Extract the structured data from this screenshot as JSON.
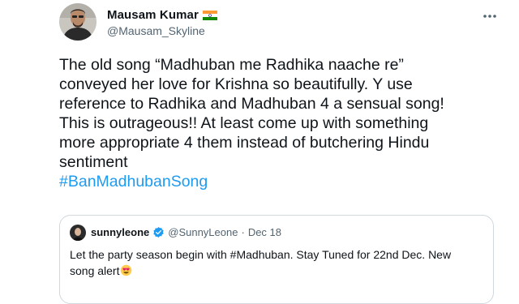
{
  "author": {
    "name": "Mausam Kumar",
    "handle": "@Mausam_Skyline",
    "flag": "india-flag-icon"
  },
  "tweet": {
    "lines": [
      "The old song “Madhuban me Radhika naache re”",
      "conveyed her love for Krishna so beautifully. Y use",
      "reference to Radhika and Madhuban 4 a sensual song!",
      "This is outrageous!! At least come up with something",
      "more appropriate 4 them instead of butchering Hindu",
      "sentiment"
    ],
    "hashtag": "#BanMadhubanSong"
  },
  "quoted": {
    "name": "sunnyleone",
    "handle": "@SunnyLeone",
    "separator": "·",
    "date": "Dec 18",
    "lines": [
      "Let the party season begin with #Madhuban. Stay Tuned for 22nd Dec. New",
      "song alert"
    ],
    "emoji": "heart-eyes-emoji"
  },
  "colors": {
    "link": "#1d9bf0",
    "secondary_text": "#536471",
    "border": "#cfd9de",
    "verified": "#1d9bf0"
  }
}
